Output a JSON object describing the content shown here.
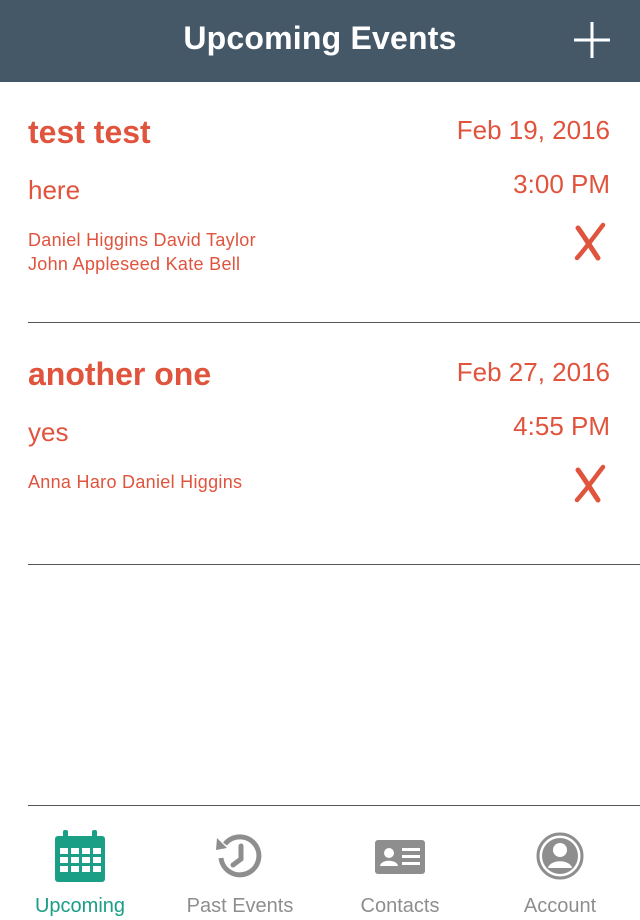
{
  "navbar": {
    "title": "Upcoming Events",
    "add_icon": "plus-icon",
    "background_color": "#455868"
  },
  "colors": {
    "accent": "#e0533d",
    "tab_active": "#1a9e86",
    "tab_inactive": "#8e8e8e"
  },
  "events": [
    {
      "title": "test test",
      "location": "here",
      "attendees_line1": "Daniel Higgins David Taylor",
      "attendees_line2": "John Appleseed Kate Bell",
      "date": "Feb 19, 2016",
      "time": "3:00 PM",
      "delete_icon": "x-mark-icon"
    },
    {
      "title": "another one",
      "location": "yes",
      "attendees_line1": "Anna Haro Daniel Higgins",
      "attendees_line2": "",
      "date": "Feb 27, 2016",
      "time": "4:55 PM",
      "delete_icon": "x-mark-icon"
    }
  ],
  "tabs": [
    {
      "label": "Upcoming",
      "icon": "calendar-icon",
      "active": true
    },
    {
      "label": "Past Events",
      "icon": "history-icon",
      "active": false
    },
    {
      "label": "Contacts",
      "icon": "contact-card-icon",
      "active": false
    },
    {
      "label": "Account",
      "icon": "user-circle-icon",
      "active": false
    }
  ]
}
